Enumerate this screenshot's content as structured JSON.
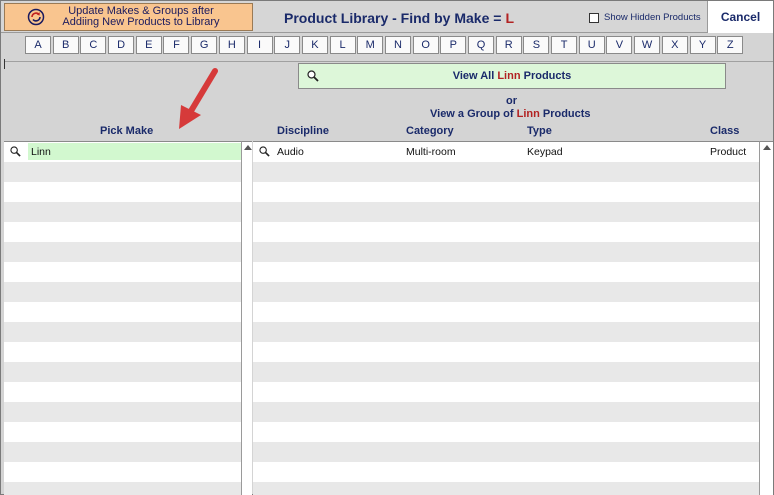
{
  "header": {
    "update_button_label_line1": "Update Makes & Groups after",
    "update_button_label_line2": "Addiing New Products to Library",
    "title": "Product Library - Find by Make =",
    "title_letter": "L",
    "show_hidden_label": "Show Hidden Products",
    "show_hidden_checked": false,
    "cancel_label": "Cancel"
  },
  "letters": [
    "A",
    "B",
    "C",
    "D",
    "E",
    "F",
    "G",
    "H",
    "I",
    "J",
    "K",
    "L",
    "M",
    "N",
    "O",
    "P",
    "Q",
    "R",
    "S",
    "T",
    "U",
    "V",
    "W",
    "X",
    "Y",
    "Z"
  ],
  "view_all": {
    "prefix": "View All",
    "make": "Linn",
    "suffix": "Products"
  },
  "or_text": "or",
  "group": {
    "prefix": "View a Group of",
    "make": "Linn",
    "suffix": "Products"
  },
  "columns": {
    "pick_make": "Pick Make",
    "discipline": "Discipline",
    "category": "Category",
    "type": "Type",
    "class": "Class"
  },
  "makes": [
    {
      "name": "Linn",
      "selected": true
    }
  ],
  "groups": [
    {
      "discipline": "Audio",
      "category": "Multi-room",
      "type": "Keypad",
      "class": "Product"
    }
  ],
  "colors": {
    "update_button_bg": "#f9c58f",
    "view_all_bg": "#ddf7d9",
    "selected_make_bg": "#d2f8cf",
    "accent_red": "#b22222",
    "title_blue": "#1a2a6a"
  }
}
